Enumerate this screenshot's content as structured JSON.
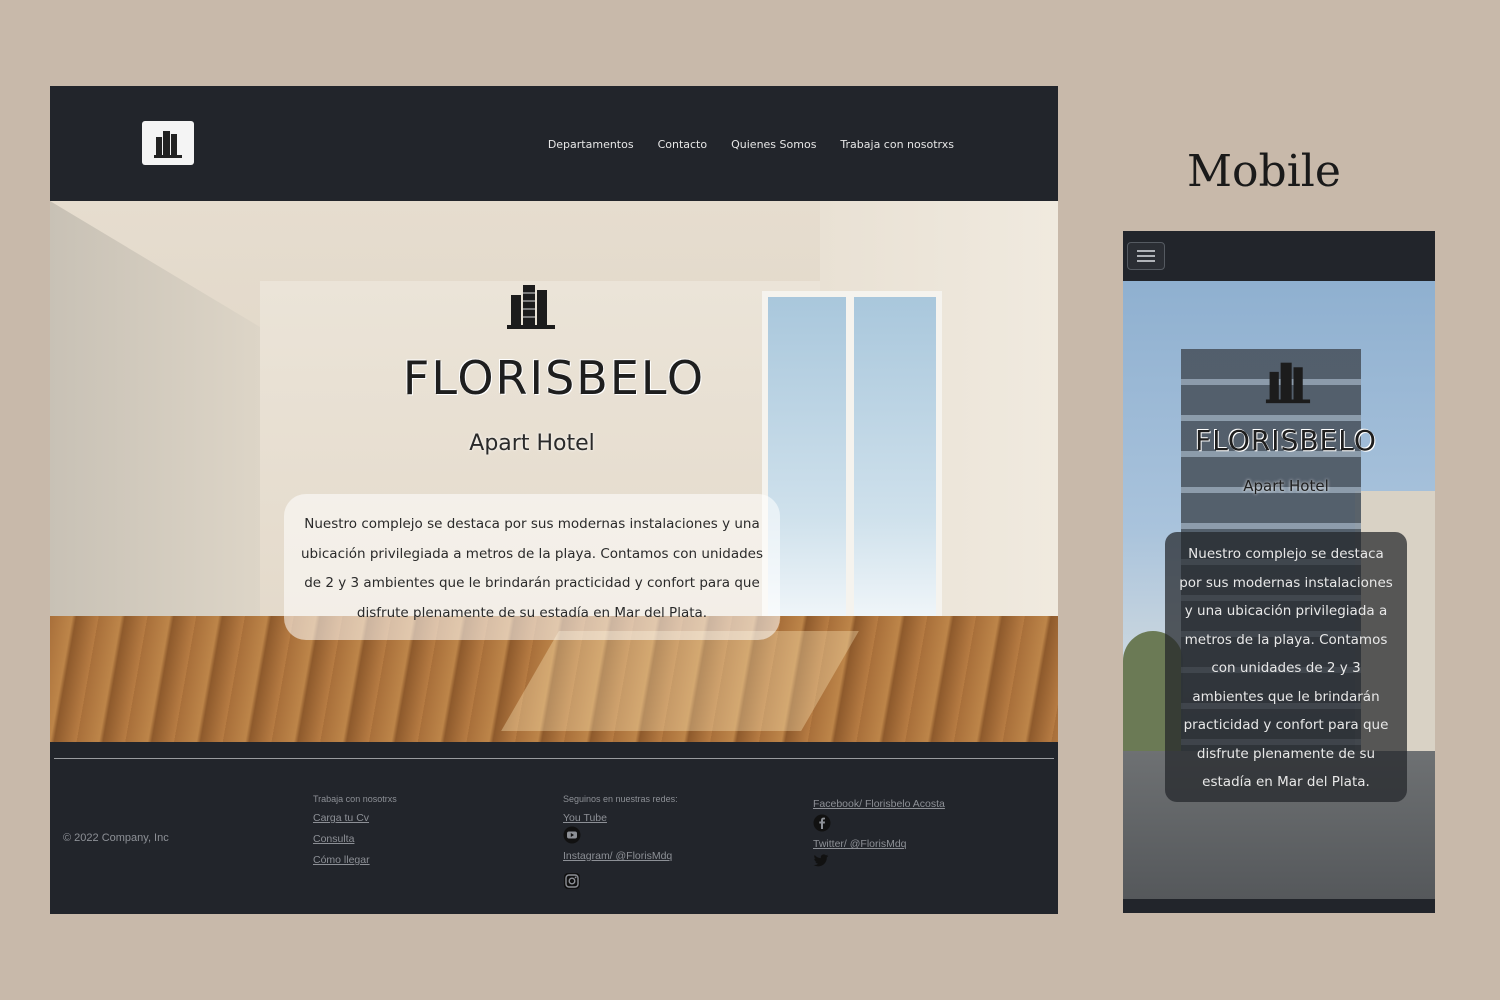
{
  "desktop": {
    "nav": {
      "items": [
        {
          "label": "Departamentos"
        },
        {
          "label": "Contacto"
        },
        {
          "label": "Quienes Somos"
        },
        {
          "label": "Trabaja con nosotrxs"
        }
      ]
    },
    "hero": {
      "brand_name": "FLORISBELO",
      "brand_sub": "Apart Hotel",
      "description": "Nuestro complejo se destaca por sus modernas instalaciones y una ubicación privilegiada a metros de la playa. Contamos con unidades de 2 y 3 ambientes que le brindarán practicidad y confort para que disfrute plenamente de su estadía en Mar del Plata."
    },
    "footer": {
      "copyright": "© 2022 Company, Inc",
      "col1": {
        "heading": "Trabaja con nosotrxs",
        "links": [
          "Carga tu Cv",
          "Consulta",
          "Cómo llegar"
        ]
      },
      "col2": {
        "heading": "Seguinos en nuestras redes:",
        "youtube": "You Tube",
        "instagram": "Instagram/ @FlorisMdq"
      },
      "col3": {
        "facebook": "Facebook/ Florisbelo Acosta",
        "twitter": "Twitter/ @FlorisMdq"
      }
    }
  },
  "mobile_label": "Mobile",
  "mobile": {
    "hero": {
      "brand_name": "FLORISBELO",
      "brand_sub": "Apart Hotel",
      "description": "Nuestro complejo se destaca por sus modernas instalaciones y una ubicación privilegiada a metros de la playa. Contamos con unidades de 2 y 3 ambientes que le brindarán practicidad y confort para que disfrute plenamente de su estadía en Mar del Plata."
    }
  },
  "colors": {
    "background": "#c8b9aa",
    "nav": "#22252b",
    "footer_text": "#8d9096"
  },
  "icons": [
    "building-logo-icon",
    "hamburger-menu-icon",
    "youtube-icon",
    "instagram-icon",
    "facebook-icon",
    "twitter-icon"
  ]
}
